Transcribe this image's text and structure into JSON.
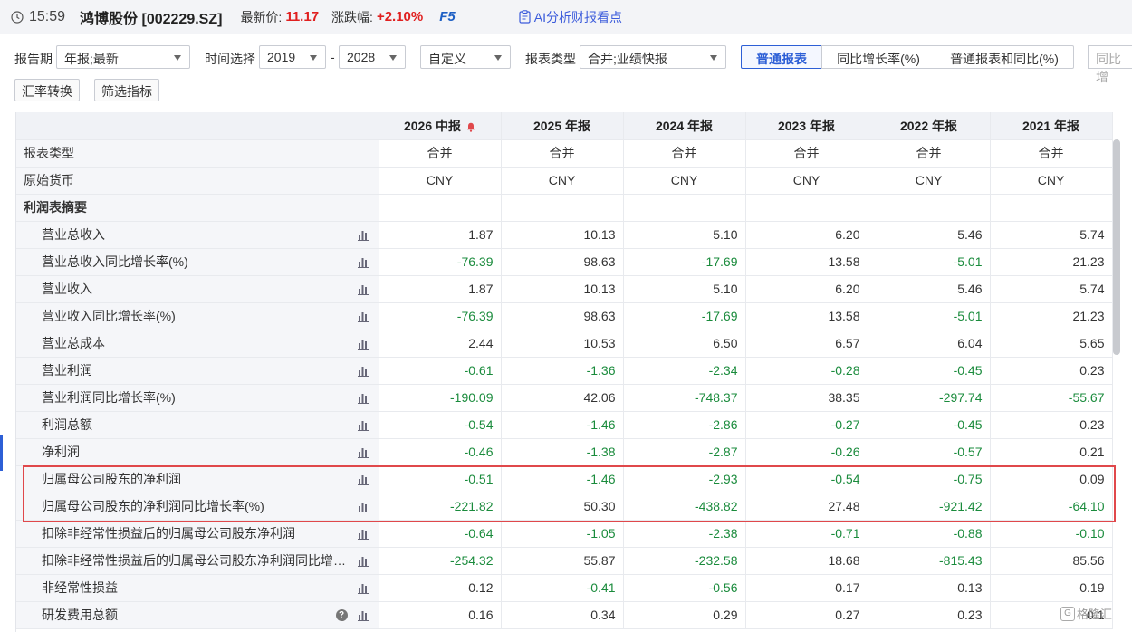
{
  "topbar": {
    "time": "15:59",
    "stock": "鸿博股份 [002229.SZ]",
    "price_label": "最新价:",
    "price": "11.17",
    "change_label": "涨跌幅:",
    "change": "+2.10%",
    "hotkey": "F5",
    "ai_label": "AI分析财报看点",
    "accent_color": "#e02020",
    "link_color": "#3b5bdb"
  },
  "filters": {
    "period_label": "报告期",
    "period_value": "年报;最新",
    "time_label": "时间选择",
    "year_from": "2019",
    "dash": "-",
    "year_to": "2028",
    "custom": "自定义",
    "type_label": "报表类型",
    "type_value": "合并;业绩快报",
    "seg_normal": "普通报表",
    "seg_yoy": "同比增长率(%)",
    "seg_both": "普通报表和同比(%)",
    "seg_cut": "同比增",
    "fx_button": "汇率转换",
    "filter_button": "筛选指标"
  },
  "table": {
    "columns": [
      "2026 中报",
      "2025 年报",
      "2024 年报",
      "2023 年报",
      "2022 年报",
      "2021 年报"
    ],
    "rows": [
      {
        "name": "报表类型",
        "kind": "meta",
        "values": [
          "合并",
          "合并",
          "合并",
          "合并",
          "合并",
          "合并"
        ]
      },
      {
        "name": "原始货币",
        "kind": "meta",
        "values": [
          "CNY",
          "CNY",
          "CNY",
          "CNY",
          "CNY",
          "CNY"
        ]
      },
      {
        "name": "利润表摘要",
        "kind": "section",
        "values": [
          "",
          "",
          "",
          "",
          "",
          ""
        ]
      },
      {
        "name": "营业总收入",
        "kind": "item",
        "values": [
          "1.87",
          "10.13",
          "5.10",
          "6.20",
          "5.46",
          "5.74"
        ]
      },
      {
        "name": "营业总收入同比增长率(%)",
        "kind": "item",
        "values": [
          "-76.39",
          "98.63",
          "-17.69",
          "13.58",
          "-5.01",
          "21.23"
        ]
      },
      {
        "name": "营业收入",
        "kind": "item",
        "values": [
          "1.87",
          "10.13",
          "5.10",
          "6.20",
          "5.46",
          "5.74"
        ]
      },
      {
        "name": "营业收入同比增长率(%)",
        "kind": "item",
        "values": [
          "-76.39",
          "98.63",
          "-17.69",
          "13.58",
          "-5.01",
          "21.23"
        ]
      },
      {
        "name": "营业总成本",
        "kind": "item",
        "values": [
          "2.44",
          "10.53",
          "6.50",
          "6.57",
          "6.04",
          "5.65"
        ]
      },
      {
        "name": "营业利润",
        "kind": "item",
        "values": [
          "-0.61",
          "-1.36",
          "-2.34",
          "-0.28",
          "-0.45",
          "0.23"
        ]
      },
      {
        "name": "营业利润同比增长率(%)",
        "kind": "item",
        "values": [
          "-190.09",
          "42.06",
          "-748.37",
          "38.35",
          "-297.74",
          "-55.67"
        ]
      },
      {
        "name": "利润总额",
        "kind": "item",
        "values": [
          "-0.54",
          "-1.46",
          "-2.86",
          "-0.27",
          "-0.45",
          "0.23"
        ]
      },
      {
        "name": "净利润",
        "kind": "item",
        "values": [
          "-0.46",
          "-1.38",
          "-2.87",
          "-0.26",
          "-0.57",
          "0.21"
        ]
      },
      {
        "name": "归属母公司股东的净利润",
        "kind": "item",
        "values": [
          "-0.51",
          "-1.46",
          "-2.93",
          "-0.54",
          "-0.75",
          "0.09"
        ]
      },
      {
        "name": "归属母公司股东的净利润同比增长率(%)",
        "kind": "item",
        "values": [
          "-221.82",
          "50.30",
          "-438.82",
          "27.48",
          "-921.42",
          "-64.10"
        ]
      },
      {
        "name": "扣除非经常性损益后的归属母公司股东净利润",
        "kind": "item",
        "values": [
          "-0.64",
          "-1.05",
          "-2.38",
          "-0.71",
          "-0.88",
          "-0.10"
        ]
      },
      {
        "name": "扣除非经常性损益后的归属母公司股东净利润同比增…",
        "kind": "item",
        "values": [
          "-254.32",
          "55.87",
          "-232.58",
          "18.68",
          "-815.43",
          "85.56"
        ]
      },
      {
        "name": "非经常性损益",
        "kind": "item",
        "values": [
          "0.12",
          "-0.41",
          "-0.56",
          "0.17",
          "0.13",
          "0.19"
        ]
      },
      {
        "name": "研发费用总额",
        "kind": "item",
        "help": true,
        "values": [
          "0.16",
          "0.34",
          "0.29",
          "0.27",
          "0.23",
          "0.1"
        ]
      }
    ],
    "negative_color": "#1a8b3c",
    "highlight_color": "#e0484b"
  },
  "watermark": "格隆汇"
}
